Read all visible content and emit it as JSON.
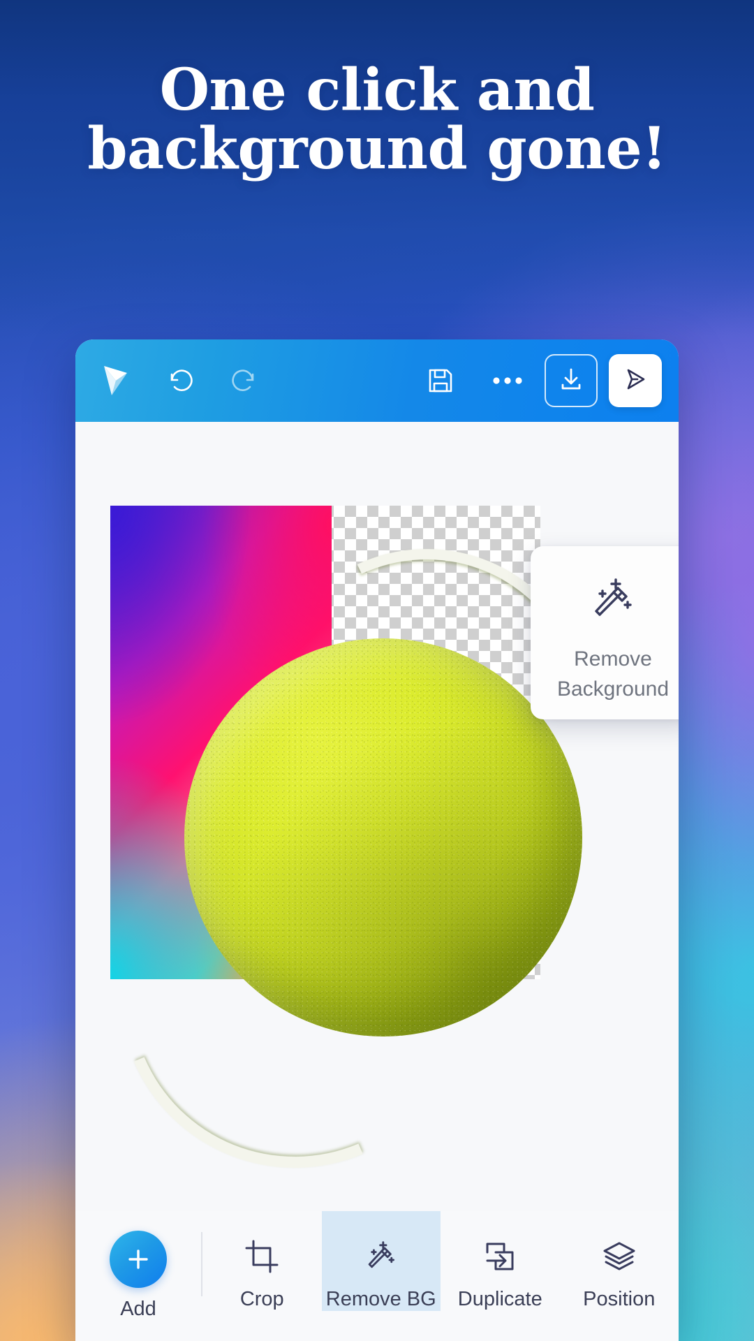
{
  "promo": {
    "headline_line1": "One click and",
    "headline_line2": "background gone!",
    "headline_color": "#ffffff"
  },
  "app": {
    "top_toolbar": {
      "logo_icon": "paper-plane-logo-icon",
      "undo_icon": "undo-arrow-icon",
      "redo_icon": "redo-arrow-icon",
      "save_icon": "floppy-save-icon",
      "more_icon": "more-options-icon",
      "download_icon": "download-icon",
      "send_icon": "send-arrow-icon",
      "bg_gradient_from": "#2eaae4",
      "bg_gradient_to": "#0d80ef"
    },
    "canvas": {
      "artboard_left_fill": "gradient",
      "artboard_right_fill": "transparent-checkerboard",
      "subject": "tennis-ball-image",
      "gradient_stops": [
        "#5b23c8",
        "#ff1170",
        "#12d4e6",
        "#ff9a24"
      ],
      "checker_color": "#cfcfcf"
    },
    "tooltip": {
      "icon": "magic-wand-icon",
      "label_line1": "Remove",
      "label_line2": "Background",
      "text_color": "#6e737e",
      "card_color": "#fdfdfd"
    },
    "bottom_toolbar": {
      "add": {
        "label": "Add",
        "icon": "plus-icon",
        "accent": "#0f7dee"
      },
      "tools": [
        {
          "label": "Crop",
          "icon": "crop-icon",
          "active": false
        },
        {
          "label": "Remove BG",
          "icon": "magic-wand-icon",
          "active": true
        },
        {
          "label": "Duplicate",
          "icon": "duplicate-icon",
          "active": false
        },
        {
          "label": "Position",
          "icon": "layers-icon",
          "active": false
        }
      ],
      "active_bg": "#d7e8f6",
      "label_color": "#3a3e55"
    }
  }
}
